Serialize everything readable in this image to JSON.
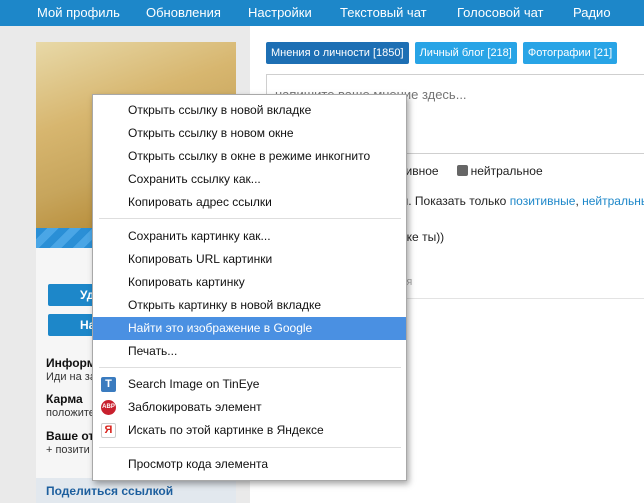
{
  "nav": {
    "items": [
      "Мой профиль",
      "Обновления",
      "Настройки",
      "Текстовый чат",
      "Голосовой чат",
      "Радио"
    ]
  },
  "sidebar": {
    "buttons": [
      "Уд",
      "На"
    ],
    "sections": [
      {
        "label": "Информ",
        "sub": "Иди на за"
      },
      {
        "label": "Карма",
        "sub": "положите"
      },
      {
        "label": "Ваше от",
        "sub": "+ позити"
      }
    ],
    "share": "Поделиться ссылкой"
  },
  "main": {
    "tabs": [
      "Мнения о личности [1850]",
      "Личный блог [218]",
      "Фотографии [21]"
    ],
    "comment_placeholder": "напишите ваше мнение здесь...",
    "filter_fragment": "тивное",
    "filter_neutral": "нейтральное",
    "show_prefix": "м. Показать только ",
    "show_positive": "позитивные",
    "show_sep": ", ",
    "show_neutral": "нейтральные",
    "show_suffix": ",",
    "hint_text": "рке ты))",
    "muted_text": "ля"
  },
  "context_menu": {
    "group1": [
      "Открыть ссылку в новой вкладке",
      "Открыть ссылку в новом окне",
      "Открыть ссылку в окне в режиме инкогнито",
      "Сохранить ссылку как...",
      "Копировать адрес ссылки"
    ],
    "group2": [
      "Сохранить картинку как...",
      "Копировать URL картинки",
      "Копировать картинку",
      "Открыть картинку в новой вкладке",
      "Найти это изображение в Google",
      "Печать..."
    ],
    "group3": [
      {
        "label": "Search Image on TinEye",
        "icon": "tineye-icon",
        "glyph": "T"
      },
      {
        "label": "Заблокировать элемент",
        "icon": "adblock-icon",
        "glyph": "ABP"
      },
      {
        "label": "Искать по этой картинке в Яндексе",
        "icon": "yandex-icon",
        "glyph": "Я"
      }
    ],
    "group4": [
      "Просмотр кода элемента"
    ],
    "highlighted": "Найти это изображение в Google"
  },
  "colors": {
    "nav_bg": "#1d87c9",
    "menu_highlight": "#4a90e2",
    "tab_active": "#1d6fb4",
    "tab_normal": "#28a4e6"
  }
}
